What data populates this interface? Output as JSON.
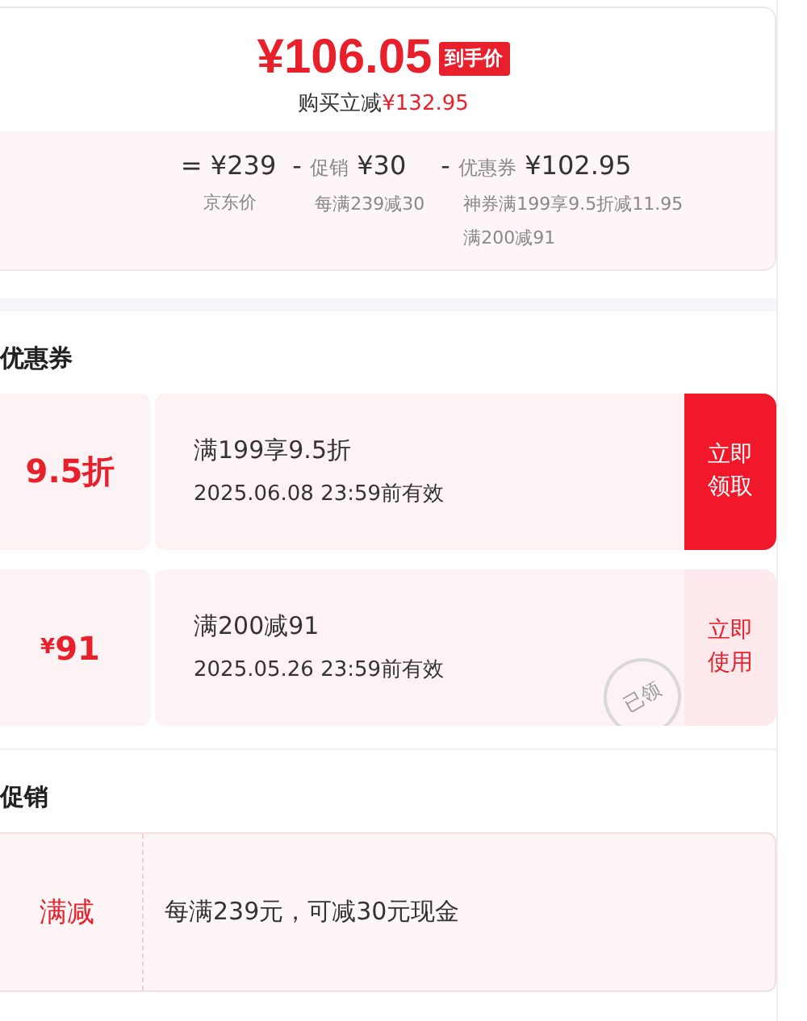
{
  "price_card": {
    "final_price": "¥106.05",
    "final_badge": "到手价",
    "saving_label": "购买立减",
    "saving_amount": "¥132.95",
    "breakdown": [
      {
        "operator": "=",
        "amount": "¥239",
        "notes": [
          "京东价"
        ]
      },
      {
        "operator": "-",
        "prefix": "促销",
        "amount": "¥30",
        "notes": [
          "每满239减30"
        ]
      },
      {
        "operator": "-",
        "prefix": "优惠券",
        "amount": "¥102.95",
        "notes": [
          "神券满199享9.5折减11.95",
          "满200减91"
        ]
      }
    ]
  },
  "coupons_section": {
    "title": "优惠券",
    "coupons": [
      {
        "value": "9.5折",
        "condition": "满199享9.5折",
        "validity": "2025.06.08 23:59前有效",
        "action": "立即领取",
        "claimed": false
      },
      {
        "value_symbol": "¥",
        "value": "91",
        "condition": "满200减91",
        "validity": "2025.05.26 23:59前有效",
        "action": "立即使用",
        "claimed": true,
        "stamp": "已领"
      }
    ]
  },
  "promotions_section": {
    "title": "促销",
    "promotions": [
      {
        "tag": "满减",
        "description": "每满239元，可减30元现金"
      }
    ]
  }
}
